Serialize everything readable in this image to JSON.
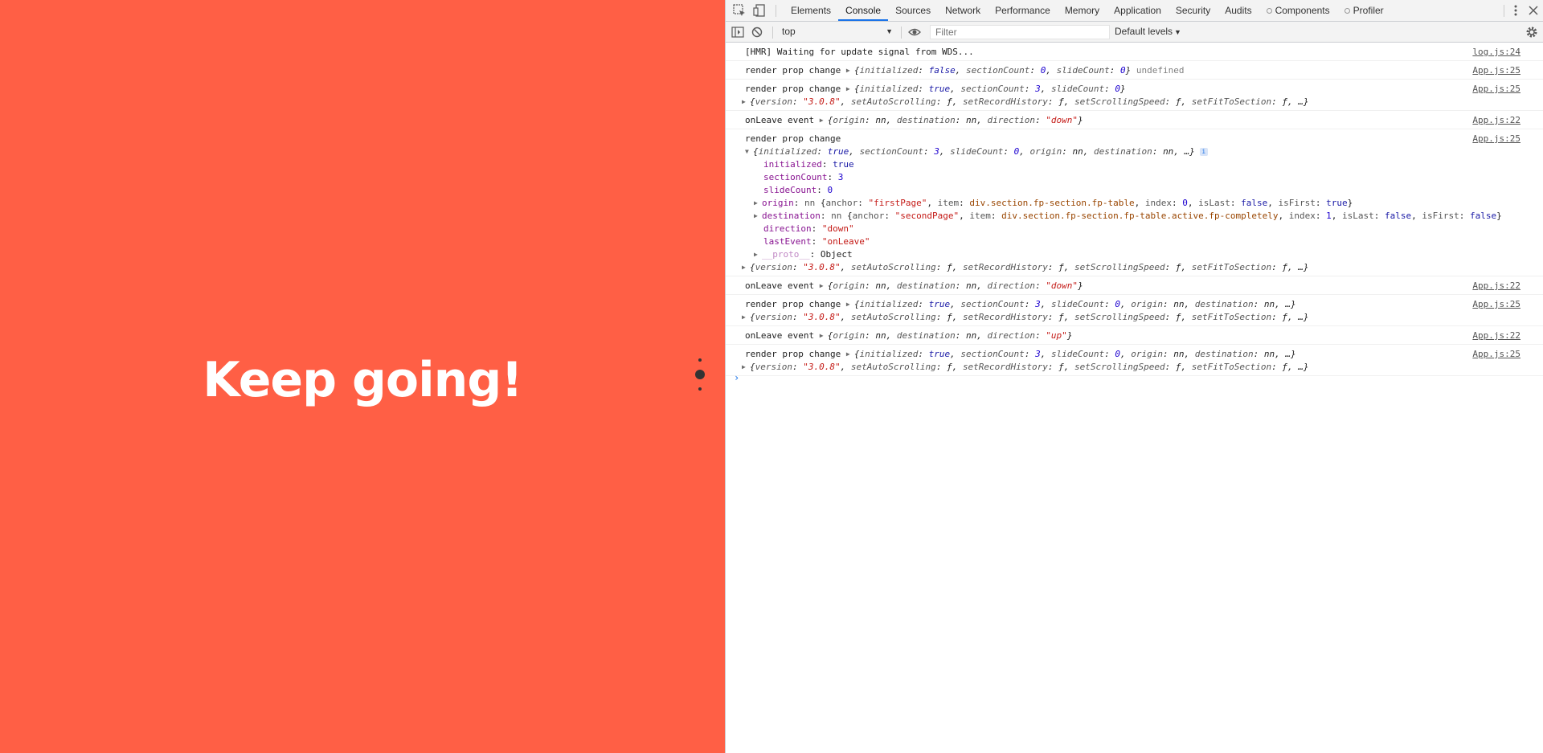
{
  "page": {
    "headline": "Keep going!",
    "background": "#ff5f45",
    "nav_dots": 3,
    "active_dot": 2
  },
  "devtools": {
    "tabs": [
      "Elements",
      "Console",
      "Sources",
      "Network",
      "Performance",
      "Memory",
      "Application",
      "Security",
      "Audits",
      "Components",
      "Profiler"
    ],
    "active_tab": "Console",
    "context": "top",
    "filter_placeholder": "Filter",
    "levels": "Default levels",
    "icons": [
      "inspect-icon",
      "device-toolbar-icon",
      "sidebar-toggle-icon",
      "clear-console-icon",
      "eye-icon",
      "settings-gear-icon",
      "more-menu-icon",
      "close-icon"
    ]
  },
  "console": {
    "m1": {
      "text": "[HMR] Waiting for update signal from WDS...",
      "src": "log.js:24"
    },
    "m2": {
      "label": "render prop change",
      "obj": {
        "a1": "{",
        "k1": "initialized",
        "v1": "false",
        "s1": ", ",
        "k2": "sectionCount",
        "v2": "0",
        "s2": ", ",
        "k3": "slideCount",
        "v3": "0",
        "end": "}"
      },
      "after": "undefined",
      "src": "App.js:25"
    },
    "m3": {
      "label": "render prop change",
      "obj": {
        "k1": "initialized",
        "v1": "true",
        "k2": "sectionCount",
        "v2": "3",
        "k3": "slideCount",
        "v3": "0"
      },
      "ver": {
        "k1": "version",
        "v1": "\"3.0.8\"",
        "k2": "setAutoScrolling",
        "k3": "setRecordHistory",
        "k4": "setScrollingSpeed",
        "k5": "setFitToSection",
        "f": "ƒ",
        "more": "…}"
      },
      "src": "App.js:25"
    },
    "m4": {
      "label": "onLeave event",
      "obj": {
        "k1": "origin",
        "v1": "nn",
        "k2": "destination",
        "v2": "nn",
        "k3": "direction",
        "v3": "\"down\""
      },
      "src": "App.js:22"
    },
    "m5": {
      "label": "render prop change",
      "summary": {
        "k1": "initialized",
        "v1": "true",
        "k2": "sectionCount",
        "v2": "3",
        "k3": "slideCount",
        "v3": "0",
        "k4": "origin",
        "v4": "nn",
        "k5": "destination",
        "v5": "nn",
        "more": "…}"
      },
      "props": {
        "initialized": {
          "k": "initialized",
          "v": "true"
        },
        "sectionCount": {
          "k": "sectionCount",
          "v": "3"
        },
        "slideCount": {
          "k": "slideCount",
          "v": "0"
        },
        "origin": {
          "k": "origin",
          "cls": "nn",
          "anchor_k": "anchor",
          "anchor_v": "\"firstPage\"",
          "item_k": "item",
          "item_v": "div.section.fp-section.fp-table",
          "index_k": "index",
          "index_v": "0",
          "islast_k": "isLast",
          "islast_v": "false",
          "isfirst_k": "isFirst",
          "isfirst_v": "true"
        },
        "destination": {
          "k": "destination",
          "cls": "nn",
          "anchor_k": "anchor",
          "anchor_v": "\"secondPage\"",
          "item_k": "item",
          "item_v": "div.section.fp-section.fp-table.active.fp-completely",
          "index_k": "index",
          "index_v": "1",
          "islast_k": "isLast",
          "islast_v": "false",
          "isfirst_k": "isFirst",
          "isfirst_v": "false"
        },
        "direction": {
          "k": "direction",
          "v": "\"down\""
        },
        "lastEvent": {
          "k": "lastEvent",
          "v": "\"onLeave\""
        },
        "proto": {
          "k": "__proto__",
          "v": "Object"
        }
      },
      "ver": {
        "k1": "version",
        "v1": "\"3.0.8\"",
        "k2": "setAutoScrolling",
        "k3": "setRecordHistory",
        "k4": "setScrollingSpeed",
        "k5": "setFitToSection",
        "f": "ƒ",
        "more": "…}"
      },
      "src": "App.js:25"
    },
    "m6": {
      "label": "onLeave event",
      "obj": {
        "k1": "origin",
        "v1": "nn",
        "k2": "destination",
        "v2": "nn",
        "k3": "direction",
        "v3": "\"down\""
      },
      "src": "App.js:22"
    },
    "m7": {
      "label": "render prop change",
      "summary": {
        "k1": "initialized",
        "v1": "true",
        "k2": "sectionCount",
        "v2": "3",
        "k3": "slideCount",
        "v3": "0",
        "k4": "origin",
        "v4": "nn",
        "k5": "destination",
        "v5": "nn",
        "more": "…}"
      },
      "ver": {
        "k1": "version",
        "v1": "\"3.0.8\"",
        "k2": "setAutoScrolling",
        "k3": "setRecordHistory",
        "k4": "setScrollingSpeed",
        "k5": "setFitToSection",
        "f": "ƒ",
        "more": "…}"
      },
      "src": "App.js:25"
    },
    "m8": {
      "label": "onLeave event",
      "obj": {
        "k1": "origin",
        "v1": "nn",
        "k2": "destination",
        "v2": "nn",
        "k3": "direction",
        "v3": "\"up\""
      },
      "src": "App.js:22"
    },
    "m9": {
      "label": "render prop change",
      "summary": {
        "k1": "initialized",
        "v1": "true",
        "k2": "sectionCount",
        "v2": "3",
        "k3": "slideCount",
        "v3": "0",
        "k4": "origin",
        "v4": "nn",
        "k5": "destination",
        "v5": "nn",
        "more": "…}"
      },
      "ver": {
        "k1": "version",
        "v1": "\"3.0.8\"",
        "k2": "setAutoScrolling",
        "k3": "setRecordHistory",
        "k4": "setScrollingSpeed",
        "k5": "setFitToSection",
        "f": "ƒ",
        "more": "…}"
      },
      "src": "App.js:25"
    },
    "prompt": "›"
  }
}
